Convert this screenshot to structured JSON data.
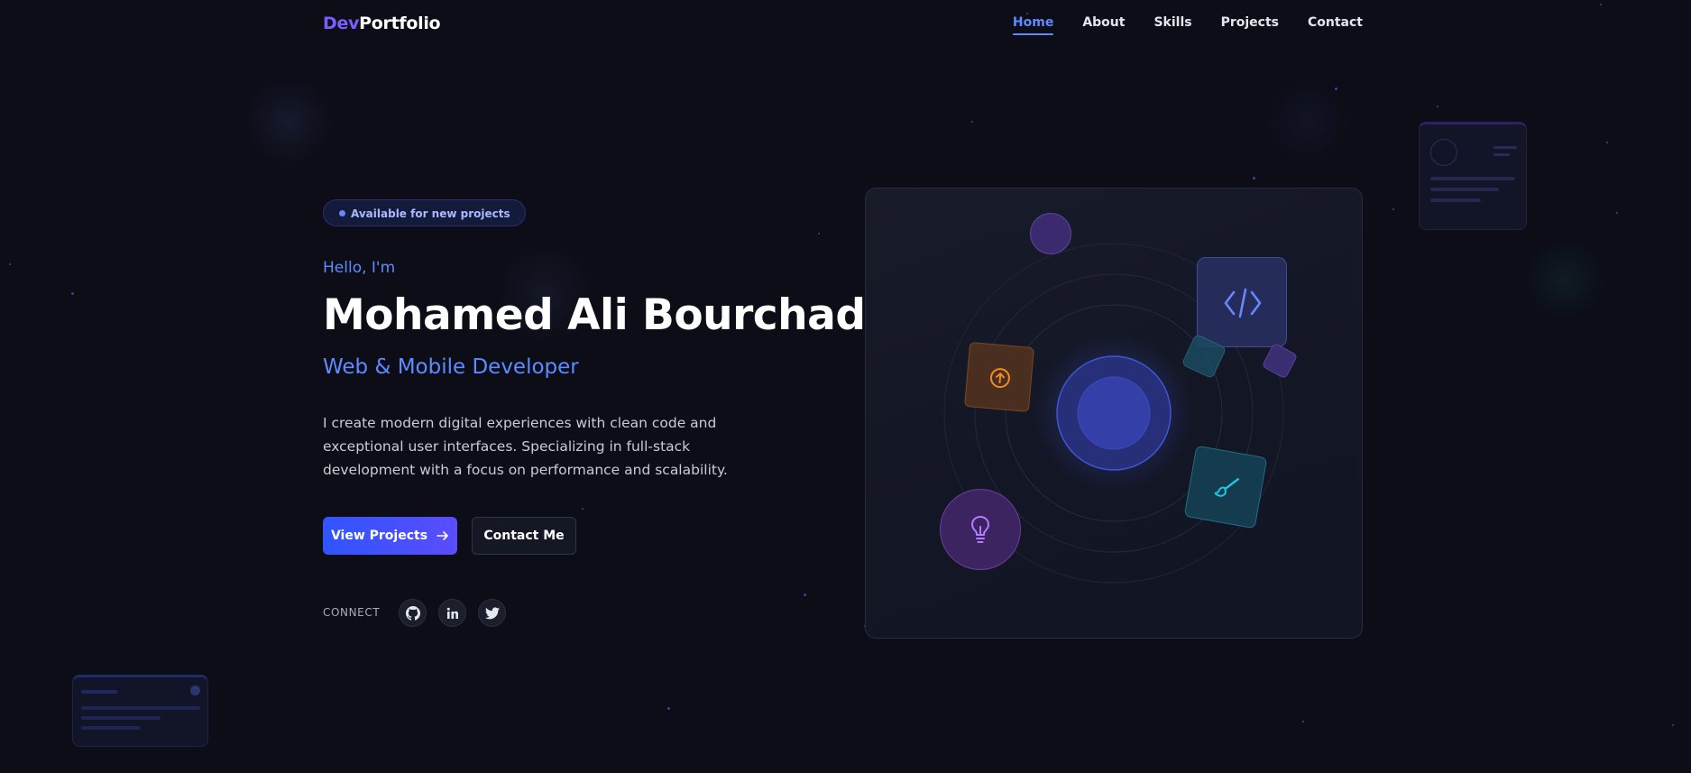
{
  "brand": {
    "logo_accent": "Dev",
    "logo_rest": "Portfolio"
  },
  "nav": {
    "items": [
      {
        "label": "Home",
        "active": true
      },
      {
        "label": "About",
        "active": false
      },
      {
        "label": "Skills",
        "active": false
      },
      {
        "label": "Projects",
        "active": false
      },
      {
        "label": "Contact",
        "active": false
      }
    ]
  },
  "hero": {
    "badge": "Available for new projects",
    "greeting": "Hello, I'm",
    "name": "Mohamed Ali Bourchada",
    "role": "Web & Mobile Developer",
    "description": "I create modern digital experiences with clean code and exceptional user interfaces. Specializing in full-stack development with a focus on performance and scalability.",
    "primary_button": "View Projects",
    "secondary_button": "Contact Me",
    "connect_label": "CONNECT",
    "socials": [
      {
        "icon": "github-icon"
      },
      {
        "icon": "linkedin-icon"
      },
      {
        "icon": "twitter-icon"
      }
    ]
  },
  "illustration": {
    "icons": [
      "code-icon",
      "upload-icon",
      "paintbrush-icon",
      "lightbulb-icon"
    ]
  },
  "colors": {
    "background": "#0c0d17",
    "accent_blue": "#5d8bff",
    "accent_purple": "#7b5cff",
    "orange": "#f08a24",
    "cyan": "#22c4e6"
  }
}
